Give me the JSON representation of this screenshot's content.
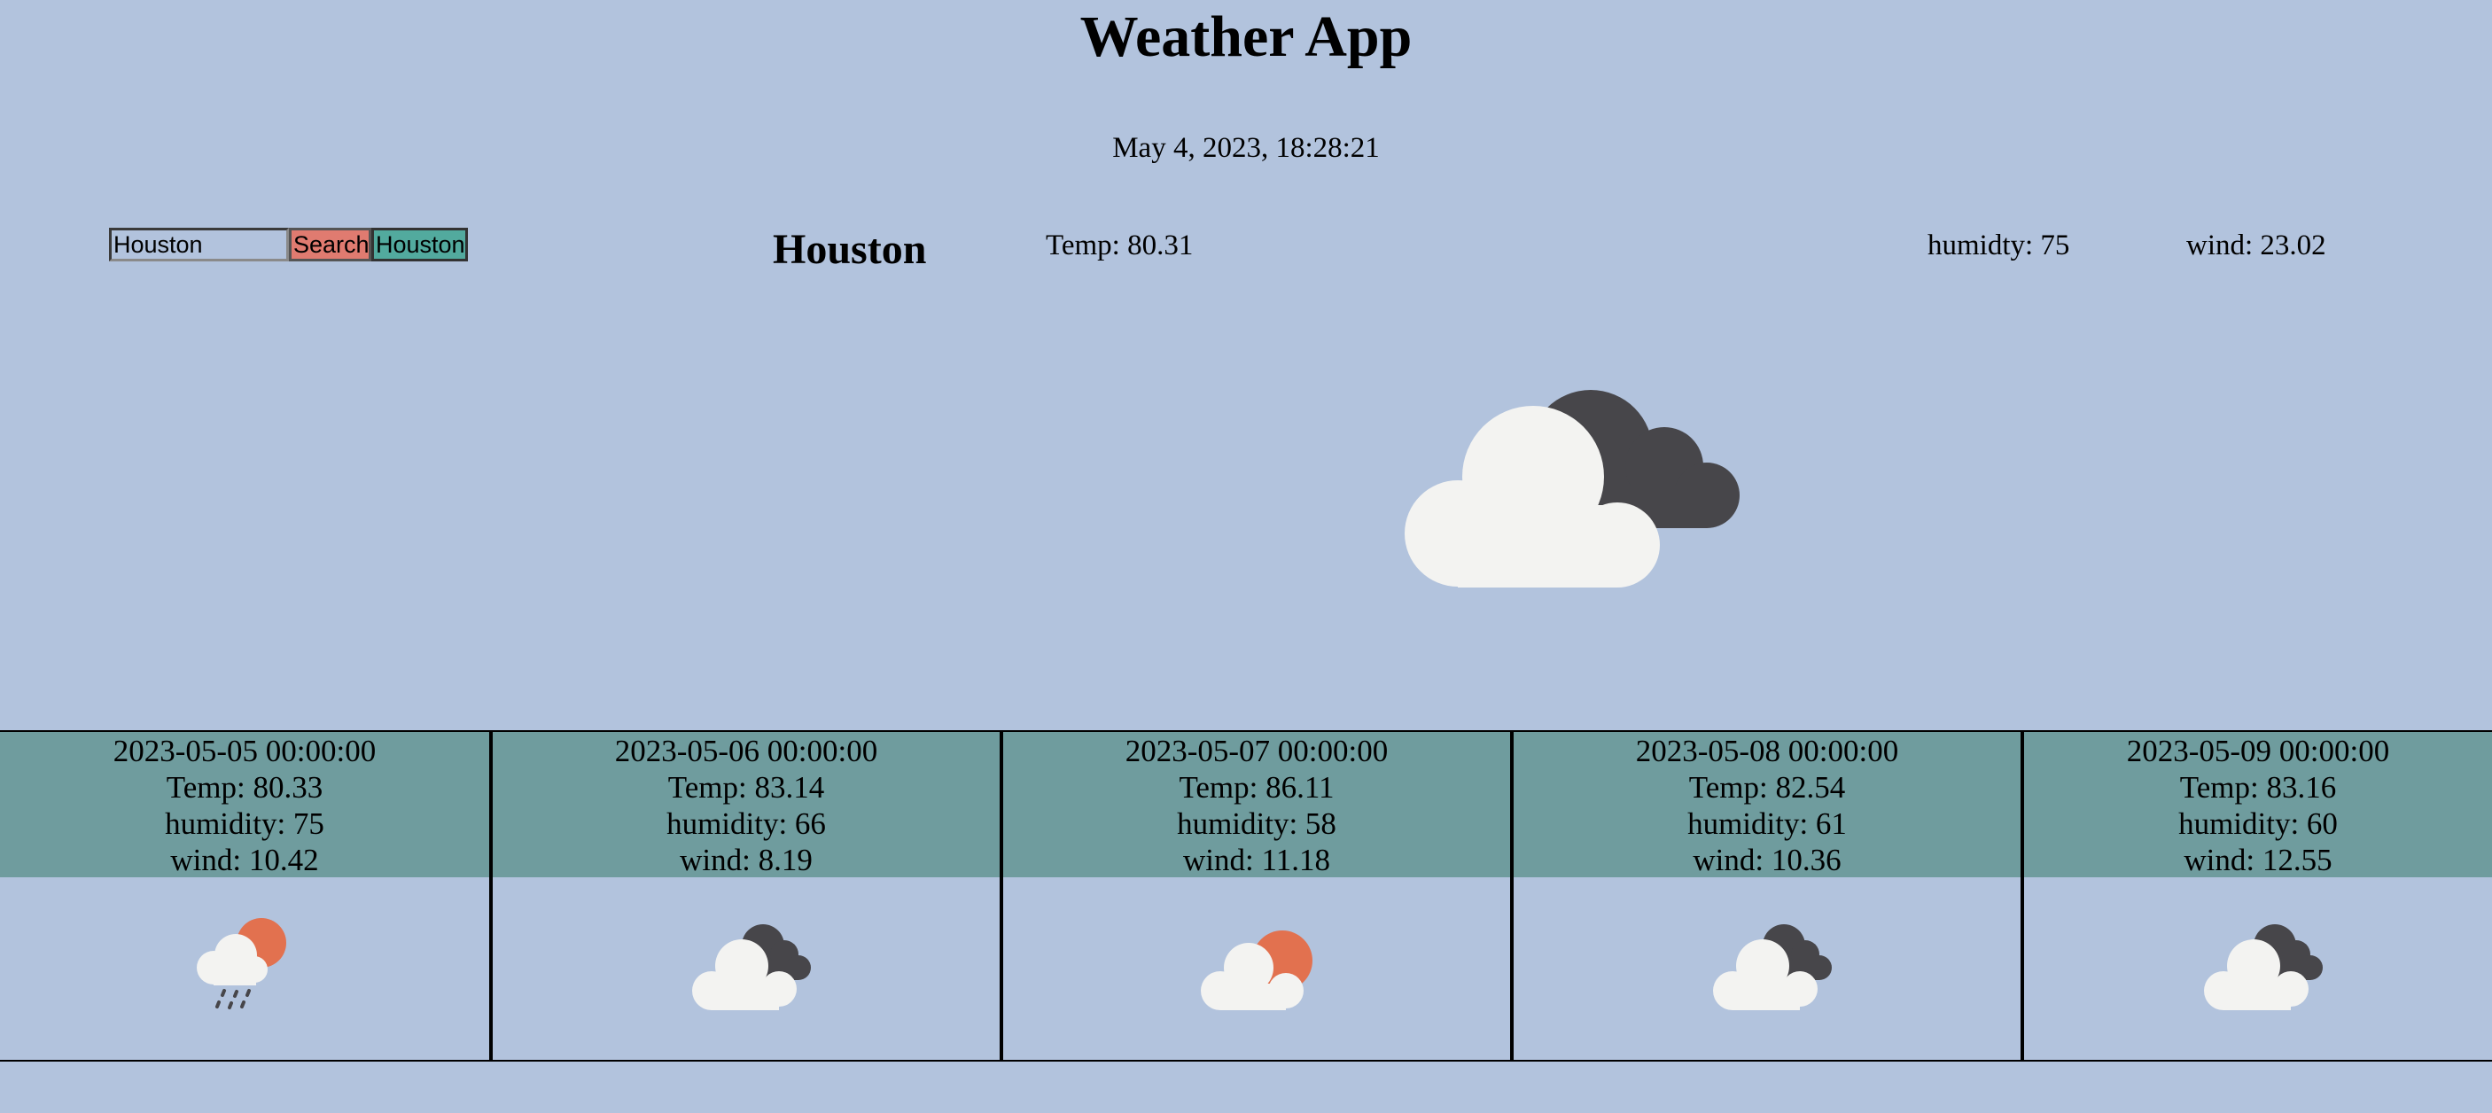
{
  "app": {
    "title": "Weather App",
    "datetime": "May 4, 2023, 18:28:21"
  },
  "search": {
    "value": "Houston",
    "search_label": "Search",
    "history": [
      "Houston"
    ]
  },
  "current": {
    "city": "Houston",
    "temp": "Temp: 80.31",
    "humidity": "humidty: 75",
    "wind": "wind: 23.02",
    "icon": "broken-clouds-icon"
  },
  "forecast": [
    {
      "date": "2023-05-05 00:00:00",
      "temp": "Temp: 80.33",
      "humidity": "humidity: 75",
      "wind": "wind: 10.42",
      "icon": "rain-sun-icon"
    },
    {
      "date": "2023-05-06 00:00:00",
      "temp": "Temp: 83.14",
      "humidity": "humidity: 66",
      "wind": "wind: 8.19",
      "icon": "broken-clouds-icon"
    },
    {
      "date": "2023-05-07 00:00:00",
      "temp": "Temp: 86.11",
      "humidity": "humidity: 58",
      "wind": "wind: 11.18",
      "icon": "partly-cloudy-icon"
    },
    {
      "date": "2023-05-08 00:00:00",
      "temp": "Temp: 82.54",
      "humidity": "humidity: 61",
      "wind": "wind: 10.36",
      "icon": "broken-clouds-icon"
    },
    {
      "date": "2023-05-09 00:00:00",
      "temp": "Temp: 83.16",
      "humidity": "humidity: 60",
      "wind": "wind: 12.55",
      "icon": "broken-clouds-icon"
    }
  ],
  "colors": {
    "background": "#b2c3dd",
    "forecast_band": "#6f9c9e",
    "search_button": "#e07b70",
    "history_button": "#52aa9e",
    "sun": "#e2714f",
    "dark_cloud": "#47464a",
    "light_cloud": "#f3f3f1"
  }
}
